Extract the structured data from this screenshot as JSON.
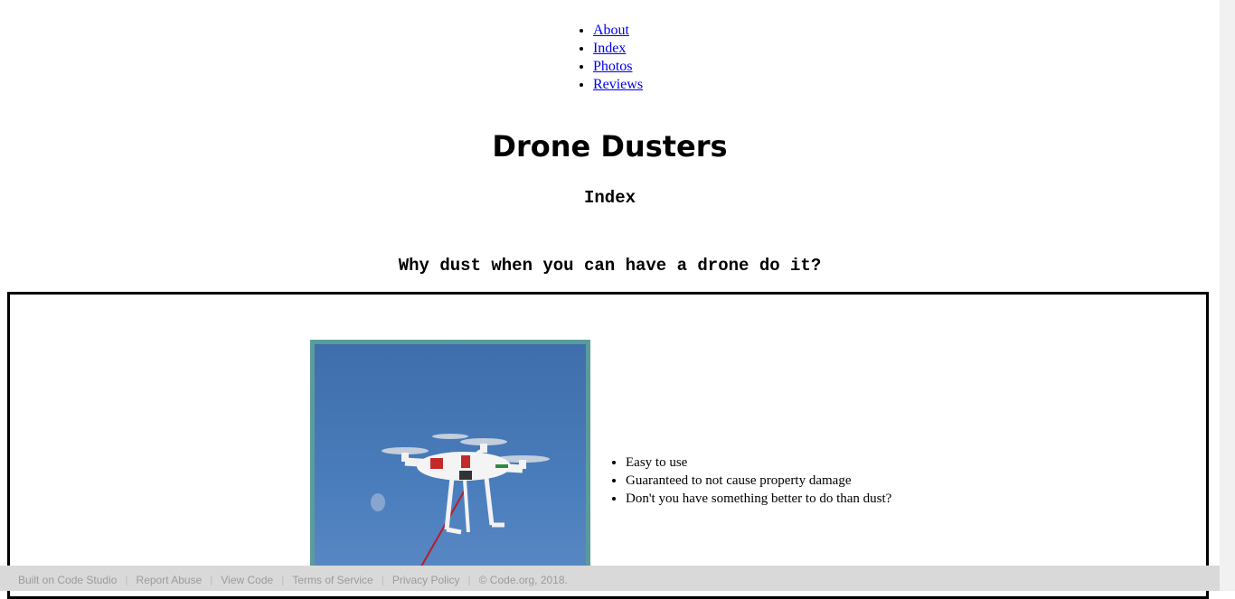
{
  "nav": {
    "items": [
      {
        "label": "About"
      },
      {
        "label": "Index"
      },
      {
        "label": "Photos"
      },
      {
        "label": "Reviews"
      }
    ]
  },
  "site": {
    "title": "Drone Dusters",
    "page_heading": "Index",
    "tagline": "Why dust when you can have a drone do it?"
  },
  "features": [
    "Easy to use",
    "Guaranteed to not cause property damage",
    "Don't you have something better to do than dust?"
  ],
  "footer": {
    "items": [
      "Built on Code Studio",
      "Report Abuse",
      "View Code",
      "Terms of Service",
      "Privacy Policy",
      "© Code.org, 2018."
    ],
    "separator": "|"
  },
  "colors": {
    "link": "#0000ee",
    "photo_frame": "#5a9b9b",
    "sky": "#4a7dbc",
    "footer_bg": "#d9d9d9",
    "footer_text": "#9b9b9b"
  }
}
